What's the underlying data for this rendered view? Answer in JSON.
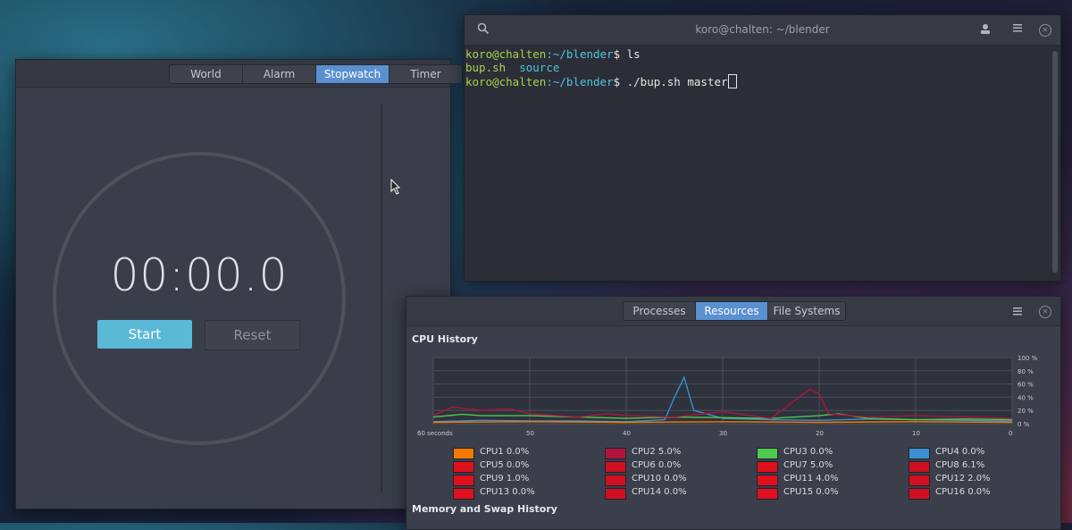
{
  "clocks": {
    "tabs": [
      "World",
      "Alarm",
      "Stopwatch",
      "Timer"
    ],
    "active_tab": 2,
    "time": "00:00.0",
    "start_label": "Start",
    "reset_label": "Reset"
  },
  "terminal": {
    "title": "koro@chalten: ~/blender",
    "lines": [
      {
        "prompt_user": "koro@chalten",
        "prompt_path": ":~/blender",
        "cmd": "$ ls"
      },
      {
        "ls": [
          "bup.sh",
          "source"
        ]
      },
      {
        "prompt_user": "koro@chalten",
        "prompt_path": ":~/blender",
        "cmd": "$ ./bup.sh master"
      }
    ],
    "icons": [
      "search-icon",
      "user-icon",
      "menu-icon",
      "close-icon"
    ]
  },
  "monitor": {
    "tabs": [
      "Processes",
      "Resources",
      "File Systems"
    ],
    "active_tab": 1,
    "cpu_title": "CPU History",
    "mem_title": "Memory and Swap History",
    "cpus": [
      {
        "label": "CPU1",
        "value": "0.0%",
        "color": "#f57900"
      },
      {
        "label": "CPU2",
        "value": "5.0%",
        "color": "#b0143c"
      },
      {
        "label": "CPU3",
        "value": "0.0%",
        "color": "#4ec94e"
      },
      {
        "label": "CPU4",
        "value": "0.0%",
        "color": "#3c8fd1"
      },
      {
        "label": "CPU5",
        "value": "0.0%",
        "color": "#e0101e"
      },
      {
        "label": "CPU6",
        "value": "0.0%",
        "color": "#d00f20"
      },
      {
        "label": "CPU7",
        "value": "5.0%",
        "color": "#e0101e"
      },
      {
        "label": "CPU8",
        "value": "6.1%",
        "color": "#d00f20"
      },
      {
        "label": "CPU9",
        "value": "1.0%",
        "color": "#e0101e"
      },
      {
        "label": "CPU10",
        "value": "0.0%",
        "color": "#d00f20"
      },
      {
        "label": "CPU11",
        "value": "4.0%",
        "color": "#e0101e"
      },
      {
        "label": "CPU12",
        "value": "2.0%",
        "color": "#d00f20"
      },
      {
        "label": "CPU13",
        "value": "0.0%",
        "color": "#e0101e"
      },
      {
        "label": "CPU14",
        "value": "0.0%",
        "color": "#d00f20"
      },
      {
        "label": "CPU15",
        "value": "0.0%",
        "color": "#e0101e"
      },
      {
        "label": "CPU16",
        "value": "0.0%",
        "color": "#d00f20"
      }
    ]
  },
  "chart_data": {
    "type": "line",
    "x_ticks": [
      "60 seconds",
      "50",
      "40",
      "30",
      "20",
      "10",
      "0"
    ],
    "y_ticks": [
      "100 %",
      "80 %",
      "60 %",
      "40 %",
      "20 %",
      "0 %"
    ],
    "ylim": [
      0,
      100
    ],
    "grid": true,
    "series": [
      {
        "name": "CPU4",
        "color": "#3c8fd1",
        "x": [
          60,
          55,
          50,
          45,
          40,
          36,
          35,
          34,
          33,
          30,
          25,
          20,
          15,
          10,
          5,
          0
        ],
        "values": [
          3,
          5,
          4,
          4,
          3,
          6,
          40,
          70,
          20,
          8,
          6,
          5,
          7,
          6,
          5,
          4
        ]
      },
      {
        "name": "CPU3",
        "color": "#4ec94e",
        "x": [
          60,
          57,
          55,
          50,
          45,
          40,
          35,
          30,
          25,
          20,
          18,
          15,
          10,
          5,
          0
        ],
        "values": [
          10,
          14,
          12,
          12,
          10,
          8,
          10,
          9,
          8,
          12,
          15,
          8,
          6,
          7,
          6
        ]
      },
      {
        "name": "CPU2",
        "color": "#b0143c",
        "x": [
          60,
          58,
          55,
          52,
          50,
          45,
          42,
          40,
          35,
          30,
          25,
          21,
          20,
          19,
          15,
          10,
          5,
          0
        ],
        "values": [
          12,
          25,
          20,
          22,
          15,
          10,
          15,
          12,
          10,
          18,
          8,
          52,
          45,
          15,
          10,
          12,
          10,
          8
        ]
      },
      {
        "name": "CPU1",
        "color": "#f57900",
        "x": [
          60,
          50,
          40,
          30,
          20,
          10,
          0
        ],
        "values": [
          2,
          3,
          2,
          3,
          2,
          3,
          2
        ]
      }
    ]
  }
}
